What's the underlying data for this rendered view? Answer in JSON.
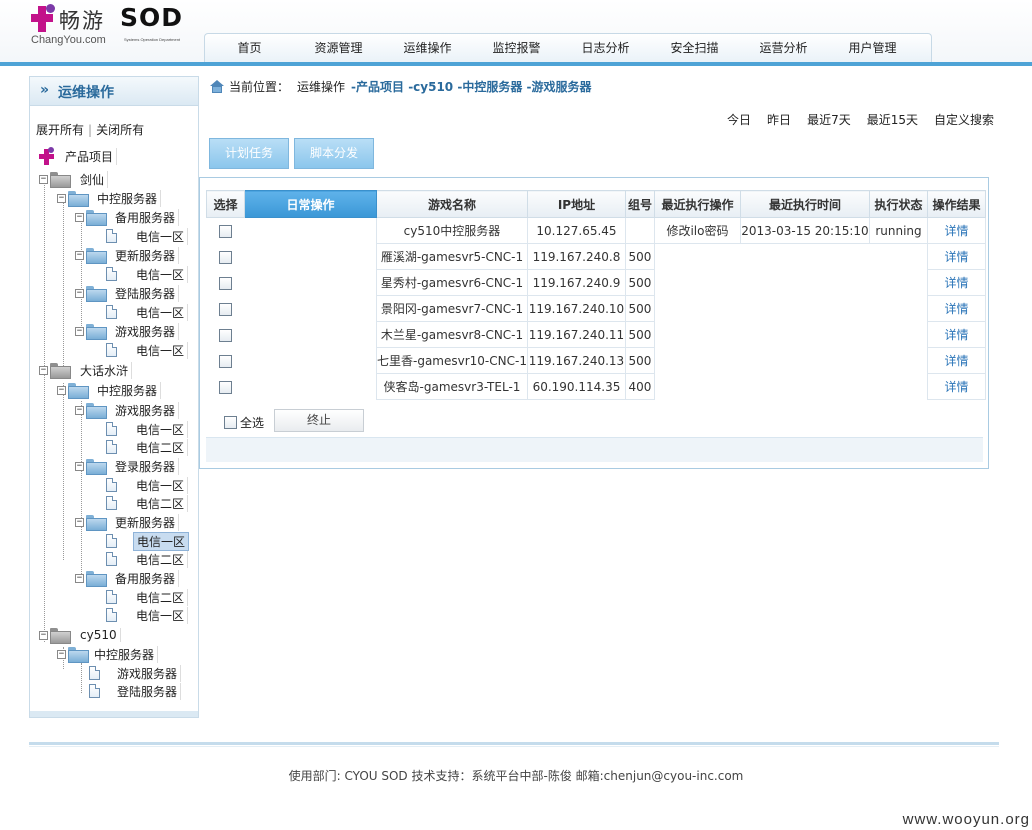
{
  "brand": {
    "name_cn": "畅游",
    "name_sod": "SOD",
    "domain": "ChangYou.com",
    "subtitle": "Systems Operation Department"
  },
  "nav": [
    "首页",
    "资源管理",
    "运维操作",
    "监控报警",
    "日志分析",
    "安全扫描",
    "运营分析",
    "用户管理"
  ],
  "sidebar": {
    "title": "运维操作",
    "expand_all": "展开所有",
    "collapse_all": "关闭所有",
    "tree": {
      "root": "产品项目",
      "jianxian": "剑仙",
      "jx_central": "中控服务器",
      "jx_backup": "备用服务器",
      "jx_backup_t1": "电信一区",
      "jx_update": "更新服务器",
      "jx_update_t1": "电信一区",
      "jx_login": "登陆服务器",
      "jx_login_t1": "电信一区",
      "jx_game": "游戏服务器",
      "jx_game_t1": "电信一区",
      "dahua": "大话水浒",
      "dh_central": "中控服务器",
      "dh_game": "游戏服务器",
      "dh_game_t1": "电信一区",
      "dh_game_t2": "电信二区",
      "dh_login": "登录服务器",
      "dh_login_t1": "电信一区",
      "dh_login_t2": "电信二区",
      "dh_update": "更新服务器",
      "dh_update_t1": "电信一区",
      "dh_update_t2": "电信二区",
      "dh_backup": "备用服务器",
      "dh_backup_t2": "电信二区",
      "dh_backup_t1": "电信一区",
      "cy510": "cy510",
      "cy_central": "中控服务器",
      "cy_game": "游戏服务器",
      "cy_login": "登陆服务器"
    }
  },
  "breadcrumb": {
    "label": "当前位置：",
    "root": "运维操作",
    "trail": "-产品项目 -cy510 -中控服务器 -游戏服务器"
  },
  "date_filter": [
    "今日",
    "昨日",
    "最近7天",
    "最近15天",
    "自定义搜索"
  ],
  "tabs": {
    "schedule": "计划任务",
    "script": "脚本分发"
  },
  "table": {
    "headers": [
      "选择",
      "日常操作",
      "游戏名称",
      "IP地址",
      "组号",
      "最近执行操作",
      "最近执行时间",
      "执行状态",
      "操作结果"
    ],
    "rows": [
      {
        "name": "cy510中控服务器",
        "ip": "10.127.65.45",
        "group": "",
        "op": "修改ilo密码",
        "time": "2013-03-15 20:15:10",
        "status": "running",
        "result": "详情"
      },
      {
        "name": "雁溪湖-gamesvr5-CNC-1",
        "ip": "119.167.240.8",
        "group": "500",
        "op": "",
        "time": "",
        "status": "",
        "result": "详情"
      },
      {
        "name": "星秀村-gamesvr6-CNC-1",
        "ip": "119.167.240.9",
        "group": "500",
        "op": "",
        "time": "",
        "status": "",
        "result": "详情"
      },
      {
        "name": "景阳冈-gamesvr7-CNC-1",
        "ip": "119.167.240.10",
        "group": "500",
        "op": "",
        "time": "",
        "status": "",
        "result": "详情"
      },
      {
        "name": "木兰星-gamesvr8-CNC-1",
        "ip": "119.167.240.11",
        "group": "500",
        "op": "",
        "time": "",
        "status": "",
        "result": "详情"
      },
      {
        "name": "七里香-gamesvr10-CNC-1",
        "ip": "119.167.240.13",
        "group": "500",
        "op": "",
        "time": "",
        "status": "",
        "result": "详情"
      },
      {
        "name": "侠客岛-gamesvr3-TEL-1",
        "ip": "60.190.114.35",
        "group": "400",
        "op": "",
        "time": "",
        "status": "",
        "result": "详情"
      }
    ],
    "select_all": "全选",
    "stop": "终止"
  },
  "footer": "使用部门: CYOU SOD 技术支持：系统平台中部-陈俊  邮箱:chenjun@cyou-inc.com",
  "watermark": "www.wooyun.org"
}
